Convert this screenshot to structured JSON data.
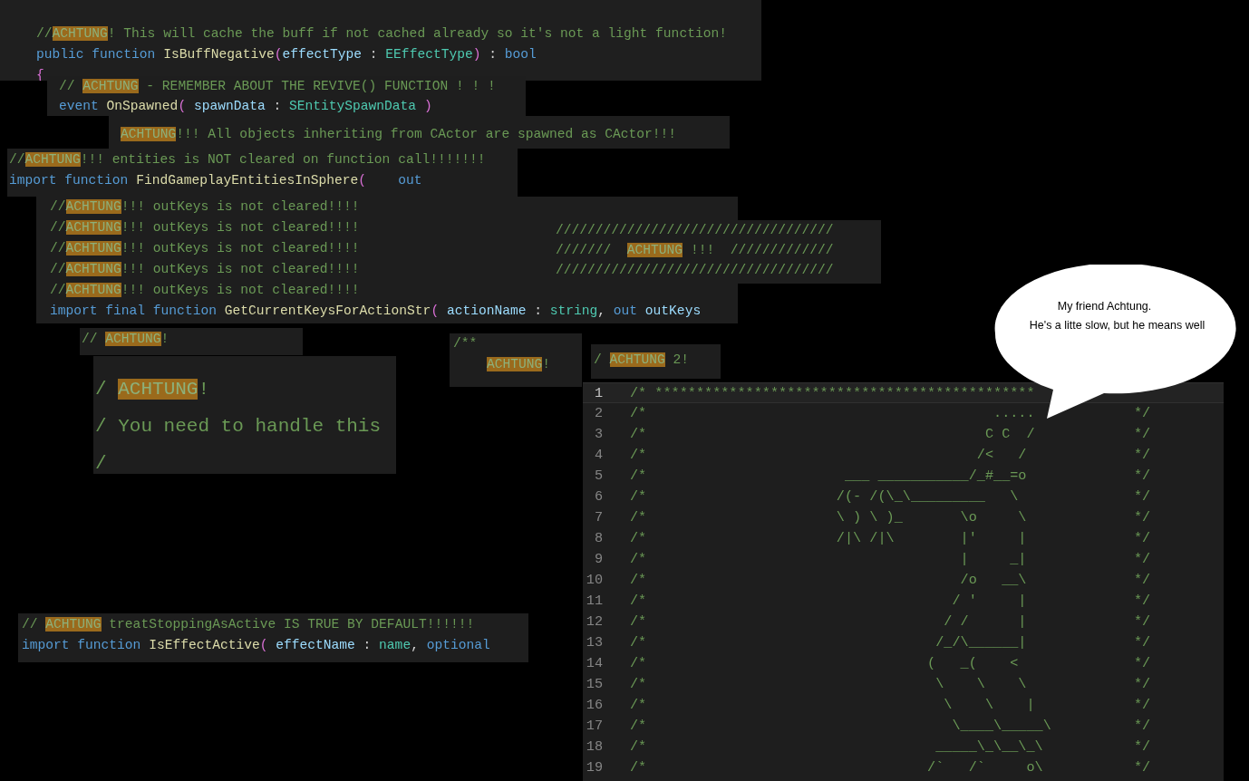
{
  "snippets": [
    {
      "lines": [
        {
          "tokens": [
            {
              "text": "//",
              "kind": "comment"
            },
            {
              "text": "ACHTUNG",
              "kind": "highlight"
            },
            {
              "text": "! This will cache the buff if not cached already so it's not a light function!",
              "kind": "comment"
            }
          ]
        },
        {
          "tokens": [
            {
              "text": "public function ",
              "kind": "keyword"
            },
            {
              "text": "IsBuffNegative",
              "kind": "function"
            },
            {
              "text": "(",
              "kind": "bracket"
            },
            {
              "text": "effectType",
              "kind": "param"
            },
            {
              "text": " : ",
              "kind": "plain"
            },
            {
              "text": "EEffectType",
              "kind": "type"
            },
            {
              "text": ")",
              "kind": "bracket"
            },
            {
              "text": " : ",
              "kind": "plain"
            },
            {
              "text": "bool",
              "kind": "keyword"
            }
          ]
        },
        {
          "tokens": [
            {
              "text": "{",
              "kind": "bracket"
            }
          ]
        }
      ]
    },
    {
      "lines": [
        {
          "tokens": [
            {
              "text": "// ",
              "kind": "comment"
            },
            {
              "text": "ACHTUNG",
              "kind": "highlight"
            },
            {
              "text": " - REMEMBER ABOUT THE REVIVE() FUNCTION ! ! !",
              "kind": "comment"
            }
          ]
        },
        {
          "tokens": [
            {
              "text": "event ",
              "kind": "keyword"
            },
            {
              "text": "OnSpawned",
              "kind": "function"
            },
            {
              "text": "( ",
              "kind": "bracket"
            },
            {
              "text": "spawnData",
              "kind": "param"
            },
            {
              "text": " : ",
              "kind": "plain"
            },
            {
              "text": "SEntitySpawnData",
              "kind": "type"
            },
            {
              "text": " )",
              "kind": "bracket"
            }
          ]
        }
      ]
    },
    {
      "lines": [
        {
          "tokens": [
            {
              "text": "ACHTUNG",
              "kind": "highlight"
            },
            {
              "text": "!!! All objects inheriting from CActor are spawned as CActor!!!",
              "kind": "comment"
            }
          ]
        }
      ]
    },
    {
      "lines": [
        {
          "tokens": [
            {
              "text": "//",
              "kind": "comment"
            },
            {
              "text": "ACHTUNG",
              "kind": "highlight"
            },
            {
              "text": "!!! entities is NOT cleared on function call!!!!!!!",
              "kind": "comment"
            }
          ]
        },
        {
          "tokens": [
            {
              "text": "import function ",
              "kind": "keyword"
            },
            {
              "text": "FindGameplayEntitiesInSphere",
              "kind": "function"
            },
            {
              "text": "(",
              "kind": "bracket"
            },
            {
              "text": "    out",
              "kind": "keyword"
            }
          ]
        }
      ]
    },
    {
      "lines": [
        {
          "tokens": [
            {
              "text": "//",
              "kind": "comment"
            },
            {
              "text": "ACHTUNG",
              "kind": "highlight"
            },
            {
              "text": "!!! outKeys is not cleared!!!!",
              "kind": "comment"
            }
          ]
        },
        {
          "tokens": [
            {
              "text": "//",
              "kind": "comment"
            },
            {
              "text": "ACHTUNG",
              "kind": "highlight"
            },
            {
              "text": "!!! outKeys is not cleared!!!!",
              "kind": "comment"
            }
          ]
        },
        {
          "tokens": [
            {
              "text": "//",
              "kind": "comment"
            },
            {
              "text": "ACHTUNG",
              "kind": "highlight"
            },
            {
              "text": "!!! outKeys is not cleared!!!!",
              "kind": "comment"
            }
          ]
        },
        {
          "tokens": [
            {
              "text": "//",
              "kind": "comment"
            },
            {
              "text": "ACHTUNG",
              "kind": "highlight"
            },
            {
              "text": "!!! outKeys is not cleared!!!!",
              "kind": "comment"
            }
          ]
        },
        {
          "tokens": [
            {
              "text": "//",
              "kind": "comment"
            },
            {
              "text": "ACHTUNG",
              "kind": "highlight"
            },
            {
              "text": "!!! outKeys is not cleared!!!!",
              "kind": "comment"
            }
          ]
        },
        {
          "tokens": [
            {
              "text": "import final function ",
              "kind": "keyword"
            },
            {
              "text": "GetCurrentKeysForActionStr",
              "kind": "function"
            },
            {
              "text": "( ",
              "kind": "bracket"
            },
            {
              "text": "actionName",
              "kind": "param"
            },
            {
              "text": " : ",
              "kind": "plain"
            },
            {
              "text": "string",
              "kind": "type"
            },
            {
              "text": ", ",
              "kind": "plain"
            },
            {
              "text": "out ",
              "kind": "keyword"
            },
            {
              "text": "outKeys",
              "kind": "param"
            }
          ]
        }
      ]
    },
    {
      "lines": [
        {
          "tokens": [
            {
              "text": "///////////////////////////////////",
              "kind": "comment"
            }
          ]
        },
        {
          "tokens": [
            {
              "text": "///////  ",
              "kind": "comment"
            },
            {
              "text": "ACHTUNG",
              "kind": "highlight"
            },
            {
              "text": " !!!  /////////////",
              "kind": "comment"
            }
          ]
        },
        {
          "tokens": [
            {
              "text": "///////////////////////////////////",
              "kind": "comment"
            }
          ]
        }
      ]
    },
    {
      "lines": [
        {
          "tokens": [
            {
              "text": "// ",
              "kind": "comment"
            },
            {
              "text": "ACHTUNG",
              "kind": "highlight"
            },
            {
              "text": "!",
              "kind": "comment"
            }
          ]
        }
      ]
    },
    {
      "lines": [
        {
          "tokens": [
            {
              "text": "/ ",
              "kind": "comment"
            },
            {
              "text": "ACHTUNG",
              "kind": "highlight"
            },
            {
              "text": "!",
              "kind": "comment"
            }
          ]
        },
        {
          "tokens": [
            {
              "text": "/ You need to handle this",
              "kind": "comment"
            }
          ]
        },
        {
          "tokens": [
            {
              "text": "/",
              "kind": "comment"
            }
          ]
        }
      ]
    },
    {
      "lines": [
        {
          "tokens": [
            {
              "text": "/**",
              "kind": "comment"
            }
          ]
        },
        {
          "tokens": [
            {
              "text": "ACHTUNG",
              "kind": "highlight"
            },
            {
              "text": "!",
              "kind": "comment"
            }
          ]
        }
      ]
    },
    {
      "lines": [
        {
          "tokens": [
            {
              "text": "/ ",
              "kind": "comment"
            },
            {
              "text": "ACHTUNG",
              "kind": "highlight"
            },
            {
              "text": " 2!",
              "kind": "comment"
            }
          ]
        }
      ]
    },
    {
      "lines": [
        {
          "tokens": [
            {
              "text": "// ",
              "kind": "comment"
            },
            {
              "text": "ACHTUNG",
              "kind": "highlight"
            },
            {
              "text": " treatStoppingAsActive IS TRUE BY DEFAULT!!!!!!",
              "kind": "comment"
            }
          ]
        },
        {
          "tokens": [
            {
              "text": "import function ",
              "kind": "keyword"
            },
            {
              "text": "IsEffectActive",
              "kind": "function"
            },
            {
              "text": "( ",
              "kind": "bracket"
            },
            {
              "text": "effectName",
              "kind": "param"
            },
            {
              "text": " : ",
              "kind": "plain"
            },
            {
              "text": "name",
              "kind": "type"
            },
            {
              "text": ", ",
              "kind": "plain"
            },
            {
              "text": "optional",
              "kind": "keyword"
            }
          ]
        }
      ]
    }
  ],
  "editor": {
    "lines": [
      {
        "number": "1",
        "active": true,
        "text": "/* **********************************************"
      },
      {
        "number": "2",
        "active": false,
        "text": "/*                                          .....            */"
      },
      {
        "number": "3",
        "active": false,
        "text": "/*                                         C C  /            */"
      },
      {
        "number": "4",
        "active": false,
        "text": "/*                                        /<   /             */"
      },
      {
        "number": "5",
        "active": false,
        "text": "/*                        ___ ___________/_#__=o             */"
      },
      {
        "number": "6",
        "active": false,
        "text": "/*                       /(- /(\\_\\_________   \\              */"
      },
      {
        "number": "7",
        "active": false,
        "text": "/*                       \\ ) \\ )_       \\o     \\             */"
      },
      {
        "number": "8",
        "active": false,
        "text": "/*                       /|\\ /|\\        |'     |             */"
      },
      {
        "number": "9",
        "active": false,
        "text": "/*                                      |     _|             */"
      },
      {
        "number": "10",
        "active": false,
        "text": "/*                                      /o   __\\             */"
      },
      {
        "number": "11",
        "active": false,
        "text": "/*                                     / '     |             */"
      },
      {
        "number": "12",
        "active": false,
        "text": "/*                                    / /      |             */"
      },
      {
        "number": "13",
        "active": false,
        "text": "/*                                   /_/\\______|             */"
      },
      {
        "number": "14",
        "active": false,
        "text": "/*                                  (   _(    <              */"
      },
      {
        "number": "15",
        "active": false,
        "text": "/*                                   \\    \\    \\             */"
      },
      {
        "number": "16",
        "active": false,
        "text": "/*                                    \\    \\    |            */"
      },
      {
        "number": "17",
        "active": false,
        "text": "/*                                     \\____\\_____\\          */"
      },
      {
        "number": "18",
        "active": false,
        "text": "/*                                   _____\\_\\__\\_\\           */"
      },
      {
        "number": "19",
        "active": false,
        "text": "/*                                  /`   /`     o\\           */"
      }
    ]
  },
  "bubble": {
    "lines": [
      "My friend Achtung.",
      "He's a litte slow, but he means well"
    ]
  }
}
